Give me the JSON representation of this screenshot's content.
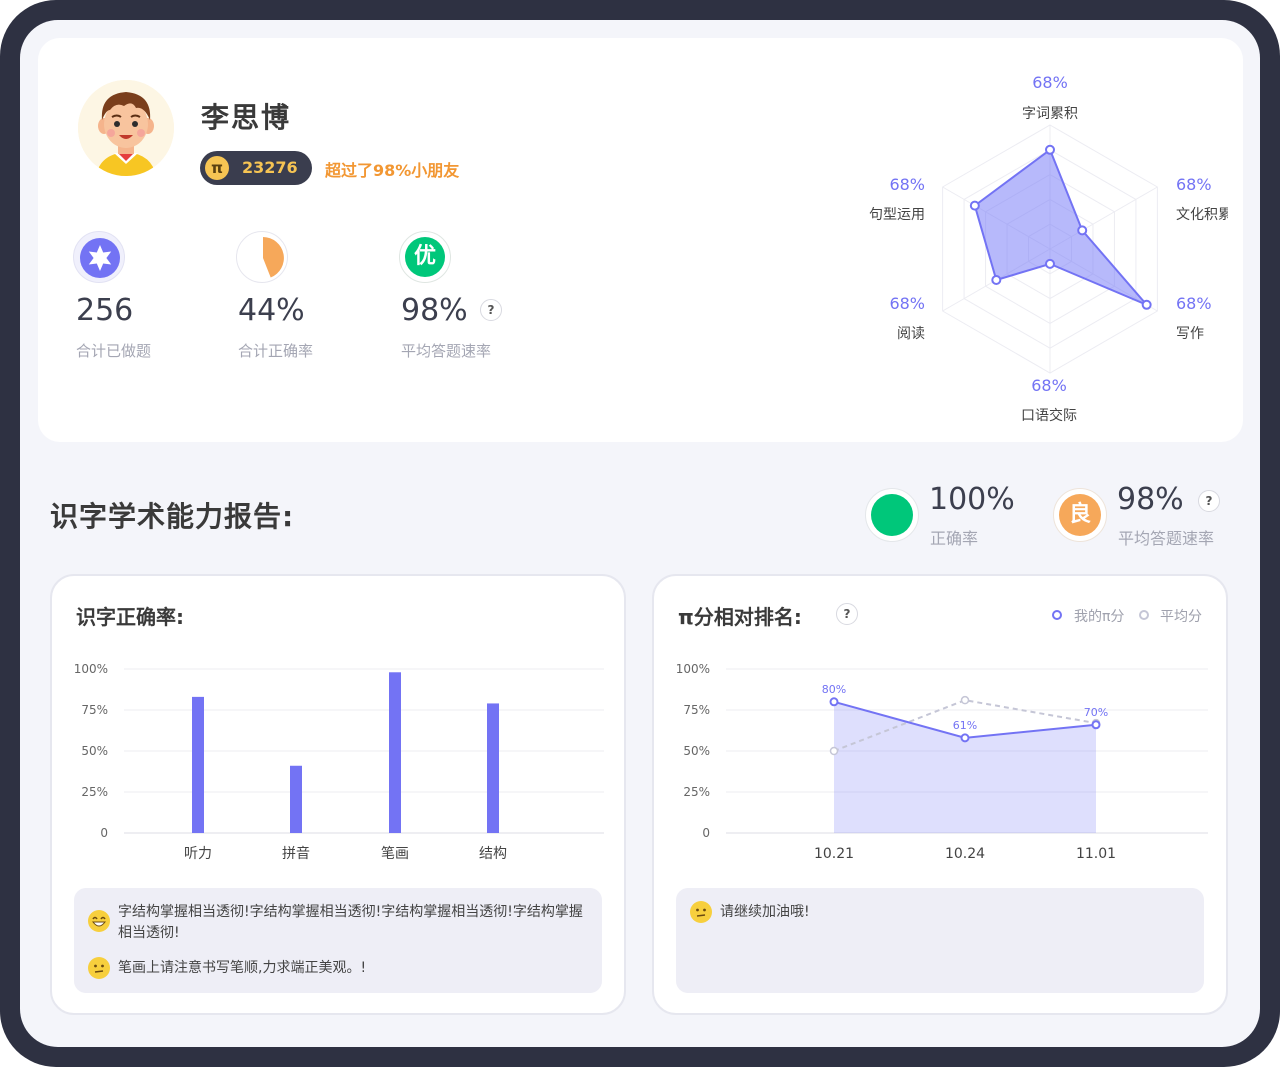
{
  "student": {
    "name": "李思博",
    "pi_symbol": "π",
    "score": "23276",
    "rank_text": "超过了98%小朋友"
  },
  "stats": [
    {
      "icon": "star-badge-icon",
      "value": "256",
      "label": "合计已做题"
    },
    {
      "icon": "pie-progress-icon",
      "value": "44%",
      "label": "合计正确率",
      "progress": 0.44
    },
    {
      "icon": "grade-badge-icon",
      "badge": "优",
      "value": "98%",
      "label": "平均答题速率"
    }
  ],
  "help_mark": "?",
  "radar": {
    "axes": [
      {
        "label": "字词累积",
        "value": "68%",
        "level": 0.8
      },
      {
        "label": "文化积累",
        "value": "68%",
        "level": 0.3
      },
      {
        "label": "写作",
        "value": "68%",
        "level": 0.9
      },
      {
        "label": "口语交际",
        "value": "68%",
        "level": 0.12
      },
      {
        "label": "阅读",
        "value": "68%",
        "level": 0.5
      },
      {
        "label": "句型运用",
        "value": "68%",
        "level": 0.7
      }
    ],
    "color": "#7b7ff7"
  },
  "report": {
    "title": "识字学术能力报告:",
    "accuracy_value": "100%",
    "accuracy_label": "正确率",
    "speed_badge": "良",
    "speed_value": "98%",
    "speed_label": "平均答题速率"
  },
  "panels": {
    "accuracy": {
      "title": "识字正确率:",
      "comments": [
        {
          "icon": "grin-emoji-icon",
          "text": "字结构掌握相当透彻!字结构掌握相当透彻!字结构掌握相当透彻!字结构掌握相当透彻!"
        },
        {
          "icon": "neutral-emoji-icon",
          "text": "笔画上请注意书写笔顺,力求端正美观。!"
        }
      ]
    },
    "ranking": {
      "title": "π分相对排名:",
      "legend_mine": "我的π分",
      "legend_avg": "平均分",
      "comments": [
        {
          "icon": "neutral-emoji-icon",
          "text": "请继续加油哦!"
        }
      ]
    }
  },
  "colors": {
    "accent": "#7373f4",
    "green": "#00c77a",
    "orange": "#f6a85a",
    "gold": "#f6c453",
    "rank_orange": "#f29733"
  },
  "chart_data": [
    {
      "type": "bar",
      "title": "识字正确率:",
      "categories": [
        "听力",
        "拼音",
        "笔画",
        "结构"
      ],
      "values": [
        83,
        41,
        98,
        79
      ],
      "yticks": [
        "100%",
        "75%",
        "50%",
        "25%",
        "0"
      ],
      "ylim": [
        0,
        100
      ],
      "grid": true
    },
    {
      "type": "line",
      "title": "π分相对排名:",
      "categories": [
        "10.21",
        "10.24",
        "11.01"
      ],
      "series": [
        {
          "name": "我的π分",
          "values": [
            80,
            58,
            66
          ],
          "labels": [
            "80%",
            "61%",
            "70%"
          ]
        },
        {
          "name": "平均分",
          "values": [
            50,
            81,
            67
          ]
        }
      ],
      "yticks": [
        "100%",
        "75%",
        "50%",
        "25%",
        "0"
      ],
      "ylim": [
        0,
        100
      ],
      "legend": "top-right",
      "grid": true
    }
  ]
}
